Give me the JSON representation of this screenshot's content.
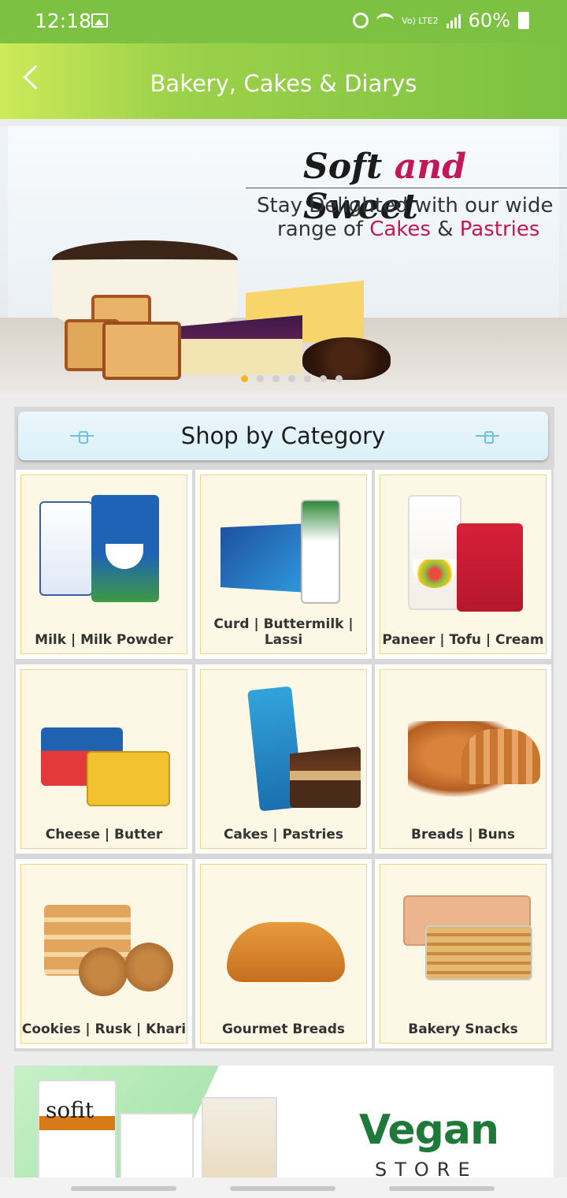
{
  "status_bar": {
    "time": "12:18",
    "network_label": "Vo) LTE2",
    "battery": "60%"
  },
  "app_bar": {
    "title": "Bakery, Cakes & Diarys",
    "back_icon": "back-arrow-icon"
  },
  "banner": {
    "headline_part1": "Soft ",
    "headline_and": "and",
    "headline_part2": " Sweet",
    "subtitle_line1": "Stay Delighted with our wide",
    "subtitle_line2_prefix": "range of ",
    "subtitle_line2_highlight": "Cakes",
    "subtitle_line2_mid": " & ",
    "subtitle_line2_highlight2": "Pastries",
    "slides": 7,
    "active_slide": 1
  },
  "shop_by_category": {
    "title": "Shop by Category",
    "categories": [
      {
        "label": "Milk | Milk Powder"
      },
      {
        "label": "Curd | Buttermilk | Lassi"
      },
      {
        "label": "Paneer | Tofu | Cream"
      },
      {
        "label": "Cheese | Butter"
      },
      {
        "label": "Cakes | Pastries"
      },
      {
        "label": "Breads | Buns"
      },
      {
        "label": "Cookies | Rusk | Khari"
      },
      {
        "label": "Gourmet Breads"
      },
      {
        "label": "Bakery Snacks"
      }
    ]
  },
  "vegan_banner": {
    "brand": "sofit",
    "title": "Vegan",
    "subtitle": "STORE"
  },
  "colors": {
    "primary": "#7cc142",
    "accent": "#c2185b",
    "tile_bg": "#fdf7e6",
    "tile_border": "#f2d57c"
  }
}
